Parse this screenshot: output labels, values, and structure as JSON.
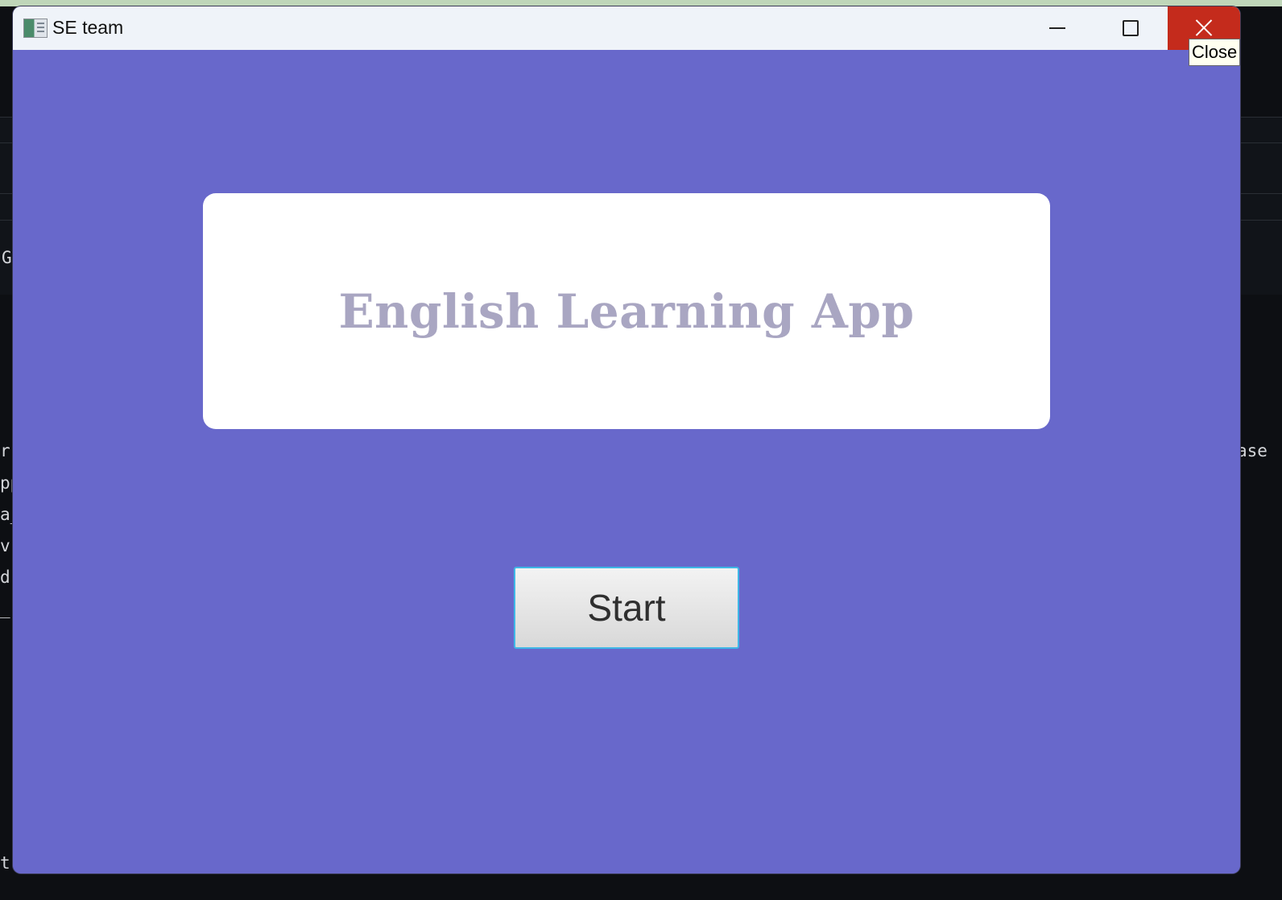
{
  "window": {
    "title": "SE team",
    "close_tooltip": "Close"
  },
  "main": {
    "app_title": "English Learning App",
    "start_label": "Start"
  },
  "background_fragments": {
    "left": [
      "G",
      "r",
      "pp",
      "a_",
      "v",
      "d:",
      "_",
      "t"
    ],
    "right": "ase"
  },
  "colors": {
    "window_background": "#6868cb",
    "titlebar": "#eff3f9",
    "close_button": "#c42b1c",
    "card": "#ffffff",
    "title_text": "#a9a6c2",
    "button_focus_border": "#3fb7e6"
  },
  "icons": {
    "app": "app-window-icon",
    "minimize": "minimize-icon",
    "maximize": "maximize-icon",
    "close": "close-icon"
  }
}
